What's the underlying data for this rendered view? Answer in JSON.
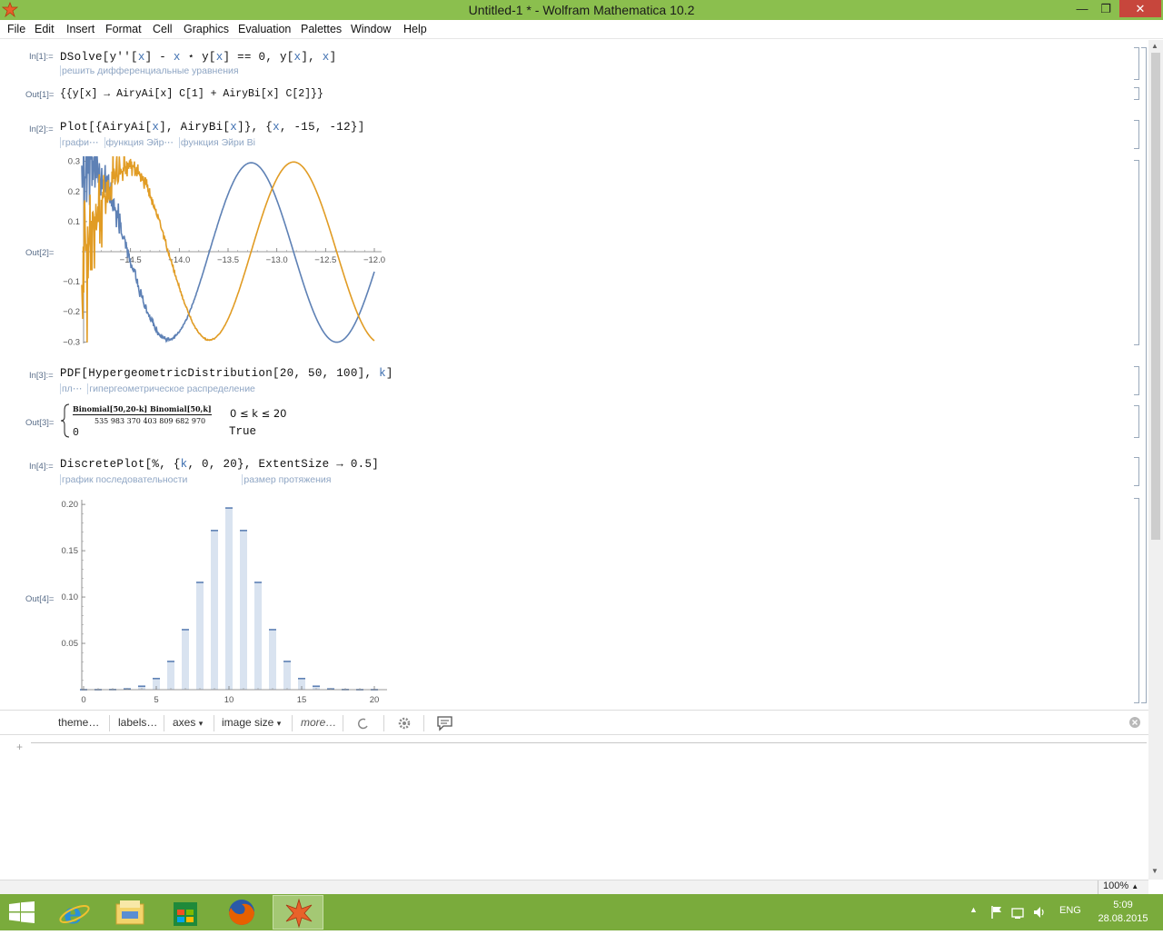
{
  "window": {
    "title": "Untitled-1 * - Wolfram Mathematica 10.2",
    "minimize": "—",
    "maximize": "❐",
    "close": "✕"
  },
  "menu": [
    "File",
    "Edit",
    "Insert",
    "Format",
    "Cell",
    "Graphics",
    "Evaluation",
    "Palettes",
    "Window",
    "Help"
  ],
  "cells": {
    "in1": {
      "label": "In[1]:=",
      "code_parts": [
        "DSolve[y''[",
        "x",
        "] - ",
        "x",
        " ⋆ y[",
        "x",
        "] == 0, ",
        "y[",
        "x",
        "], ",
        "x",
        "]"
      ],
      "hint": "решить дифференциальные уравнения"
    },
    "out1": {
      "label": "Out[1]=",
      "text": "{{y[x] → AiryAi[x] C[1] + AiryBi[x] C[2]}}"
    },
    "in2": {
      "label": "In[2]:=",
      "code_parts": [
        "Plot[{AiryAi[",
        "x",
        "], AiryBi[",
        "x",
        "]}, {",
        "x",
        ", -15, -12}]"
      ],
      "hints": [
        "графи⋯",
        "функция Эйр⋯",
        "функция Эйри Bi"
      ]
    },
    "out2": {
      "label": "Out[2]=",
      "chart_data": {
        "type": "line",
        "title": "",
        "xlabel": "",
        "ylabel": "",
        "xlim": [
          -15,
          -12
        ],
        "ylim": [
          -0.3,
          0.3
        ],
        "x_ticks": [
          "-14.5",
          "-14.0",
          "-13.5",
          "-13.0",
          "-12.5",
          "-12.0"
        ],
        "x_tick_values": [
          -14.5,
          -14.0,
          -13.5,
          -13.0,
          -12.5,
          -12.0
        ],
        "y_ticks": [
          "0.3",
          "0.2",
          "0.1",
          "−0.1",
          "−0.2",
          "−0.3"
        ],
        "y_tick_values": [
          0.3,
          0.2,
          0.1,
          -0.1,
          -0.2,
          -0.3
        ],
        "grid": false,
        "series": [
          {
            "color": "#5e81b5",
            "function": "AiryAi(x)"
          },
          {
            "color": "#e19c24",
            "function": "AiryBi(x)"
          }
        ]
      }
    },
    "in3": {
      "label": "In[3]:=",
      "code_parts": [
        "PDF[HypergeometricDistribution[20, 50, 100], ",
        "k",
        "]"
      ],
      "hints": [
        "пл⋯",
        "гипергеометрическое распределение"
      ]
    },
    "out3": {
      "label": "Out[3]=",
      "numerator": "Binomial[50,20-k] Binomial[50,k]",
      "denominator": "535 983 370 403 809 682 970",
      "condition1": "0 ≤ k ≤ 20",
      "value2": "0",
      "condition2": "True"
    },
    "in4": {
      "label": "In[4]:=",
      "code_parts": [
        "DiscretePlot[%, {",
        "k",
        ", 0, 20}, ExtentSize → 0.5]"
      ],
      "hints": [
        "график последовательности",
        "размер протяжения"
      ]
    },
    "out4": {
      "label": "Out[4]=",
      "chart_data": {
        "type": "bar",
        "title": "",
        "xlabel": "",
        "ylabel": "",
        "xlim": [
          0,
          20
        ],
        "ylim": [
          0,
          0.2
        ],
        "x_ticks": [
          "0",
          "5",
          "10",
          "15",
          "20"
        ],
        "x_tick_values": [
          0,
          5,
          10,
          15,
          20
        ],
        "y_ticks": [
          "0.20",
          "0.15",
          "0.10",
          "0.05"
        ],
        "y_tick_values": [
          0.2,
          0.15,
          0.1,
          0.05
        ],
        "categories": [
          0,
          1,
          2,
          3,
          4,
          5,
          6,
          7,
          8,
          9,
          10,
          11,
          12,
          13,
          14,
          15,
          16,
          17,
          18,
          19,
          20
        ],
        "values": [
          0.0,
          0.0,
          0.0001,
          0.0008,
          0.0037,
          0.012,
          0.0305,
          0.0648,
          0.1158,
          0.1718,
          0.1961,
          0.1718,
          0.1158,
          0.0648,
          0.0305,
          0.012,
          0.0037,
          0.0008,
          0.0001,
          0.0,
          0.0
        ],
        "bar_color": "#d9e3f0",
        "cap_color": "#5e81b5"
      }
    }
  },
  "suggestions": {
    "items": [
      "theme…",
      "labels…",
      "axes",
      "image size",
      "more…"
    ],
    "dropdown_marker": "▾"
  },
  "status": {
    "zoom": "100%"
  },
  "taskbar": {
    "lang": "ENG",
    "time": "5:09",
    "date": "28.08.2015"
  },
  "colors": {
    "titlebar": "#8bbf4e",
    "taskbar": "#7aab3c",
    "airy_ai": "#5e81b5",
    "airy_bi": "#e19c24"
  }
}
